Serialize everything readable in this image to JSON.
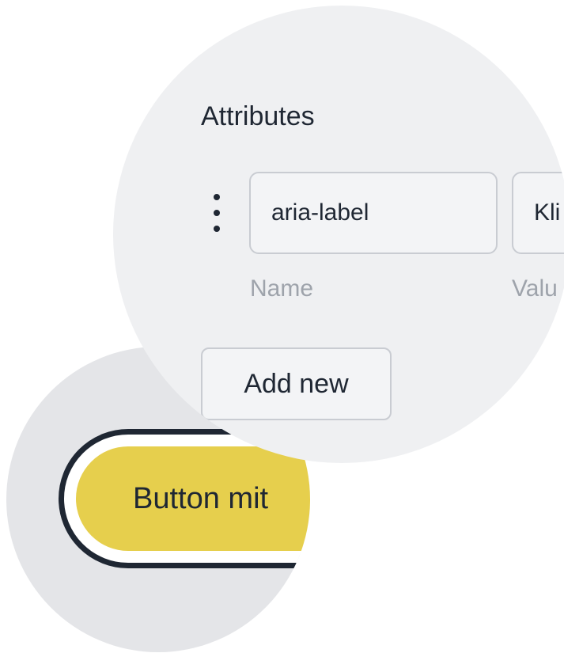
{
  "attributes_panel": {
    "heading": "Attributes",
    "rows": [
      {
        "name_value": "aria-label",
        "value_value": "Kli",
        "name_caption": "Name",
        "value_caption": "Valu"
      }
    ],
    "add_button_label": "Add new",
    "drag_icon": "vertical-ellipsis-icon"
  },
  "button_preview": {
    "label": "Button mit",
    "fill_color": "#e6cf4d",
    "focus_ring_color": "#1f2733"
  },
  "colors": {
    "lens_light": "#eff0f2",
    "lens_gray": "#e4e5e8",
    "text_dark": "#1f2733",
    "caption_gray": "#9ea3ab",
    "field_border": "#c9ccd2"
  }
}
